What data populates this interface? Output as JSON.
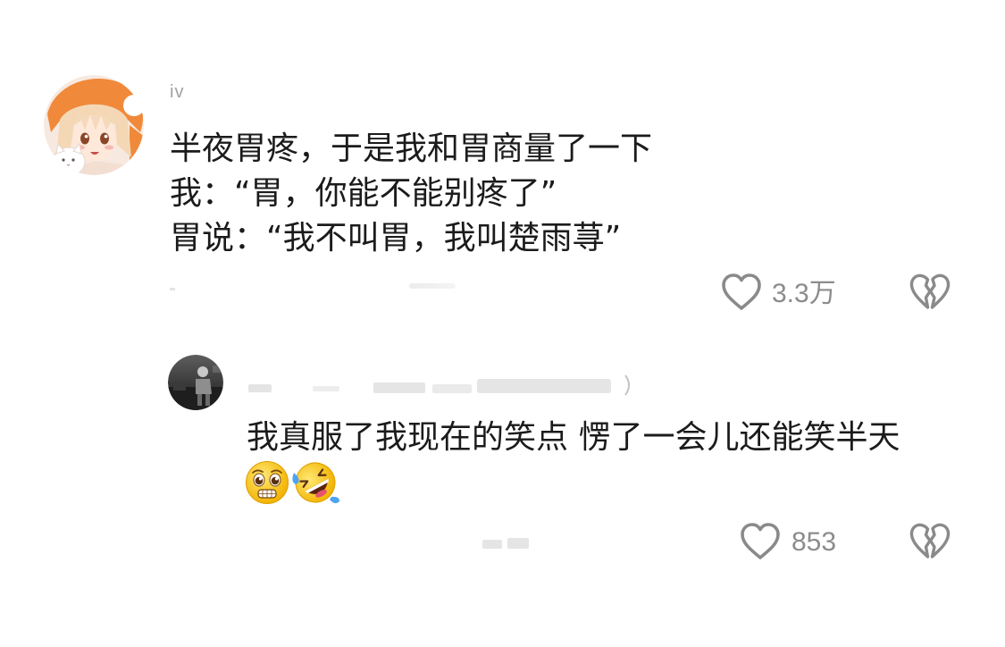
{
  "colors": {
    "background": "#ffffff",
    "text": "#1b1b1b",
    "meta": "#8c8c8c",
    "icon": "#8a8a8a"
  },
  "comments": [
    {
      "avatar_icon": "anime-girl-avatar",
      "username": "iv",
      "lines": [
        "半夜胃疼，于是我和胃商量了一下",
        "我：“胃，你能不能别疼了”",
        "胃说：“我不叫胃，我叫楚雨荨”"
      ],
      "like_icon": "heart-outline-icon",
      "like_count": "3.3万",
      "dislike_icon": "broken-heart-icon"
    },
    {
      "avatar_icon": "dark-photo-avatar",
      "text": "我真服了我现在的笑点 愣了一会儿还能笑半天",
      "emojis": [
        "pleading-grimace-emoji",
        "rolling-laughing-emoji"
      ],
      "like_icon": "heart-outline-icon",
      "like_count": "853",
      "dislike_icon": "broken-heart-icon"
    }
  ]
}
